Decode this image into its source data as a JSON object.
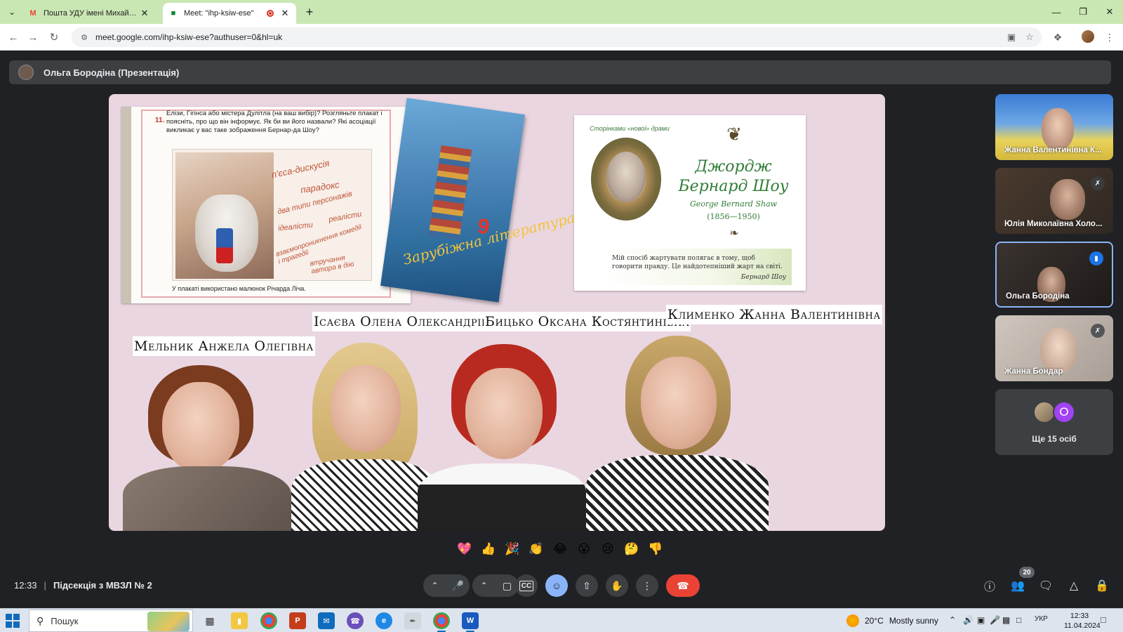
{
  "browser": {
    "tabs": [
      {
        "title": "Пошта УДУ імені Михайла Др",
        "favicon": "gmail-icon"
      },
      {
        "title": "Meet: \"ihp-ksiw-ese\"",
        "favicon": "meet-icon"
      }
    ],
    "url": "meet.google.com/ihp-ksiw-ese?authuser=0&hl=uk"
  },
  "meet": {
    "presenter_label": "Ольга Бородіна (Презентація)",
    "time": "12:33",
    "meeting_name": "Підсекція з МВЗЛ № 2",
    "participant_count": "20",
    "more_people": "Ще 15 осіб",
    "more_avatar_letter": "О",
    "participants": [
      {
        "name": "Жанна Валентинівна К...",
        "muted": false
      },
      {
        "name": "Юлія Миколаївна Холо...",
        "muted": true
      },
      {
        "name": "Ольга Бородіна",
        "speaking": true
      },
      {
        "name": "Жанна Бондар",
        "muted": true
      }
    ],
    "reactions": [
      "💖",
      "👍",
      "🎉",
      "👏",
      "😂",
      "😮",
      "😢",
      "🤔",
      "👎"
    ]
  },
  "slide": {
    "textbook_question_number": "11.",
    "textbook_question": "Елізи, Гігінса або містера Дулітла (на ваш вибір)? Розгляньте плакат і поясніть, про що він інформує. Як би ви його назвали? Які асоціації викликає у вас таке зображення Бернар-да Шоу?",
    "poster_words": [
      "п'єса-дискусія",
      "парадокс",
      "два типи персонажів",
      "ідеалісти",
      "реалісти",
      "взаємопроникнення комедії і трагедії",
      "втручання автора в дію"
    ],
    "poster_caption": "У плакаті використано малюнок Річарда Ліча.",
    "book_title": "Зарубіжна література",
    "book_number": "9",
    "shaw_series": "Сторінками «нової» драми",
    "shaw_name": "Джордж Бернард Шоу",
    "shaw_english": "George Bernard Shaw",
    "shaw_years": "(1856—1950)",
    "shaw_quote": "Мій спосіб жартувати полягає в тому, щоб говорити правду. Це найдотепніший жарт на світі.",
    "shaw_quote_author": "Бернард Шоу",
    "names": [
      "Мельник Анжела Олегівна",
      "Ісаєва Олена Олександрівна",
      "Бицько Оксана Костянтинівна",
      "Клименко Жанна Валентинівна"
    ]
  },
  "taskbar": {
    "search_placeholder": "Пошук",
    "temperature": "20°C",
    "weather": "Mostly sunny",
    "language": "УКР",
    "time": "12:33",
    "date": "11.04.2024"
  }
}
